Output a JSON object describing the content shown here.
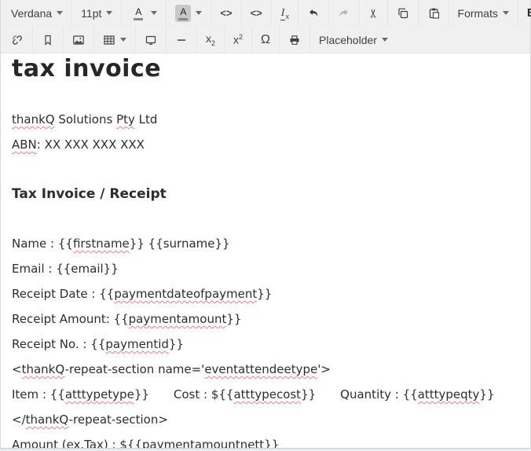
{
  "colors": {
    "toolbar_bg": "#f0f0f1",
    "icon": "#404040",
    "text": "#2d2d2d",
    "spellcheck_underline": "#f28080",
    "color_swatch": "#8a8a8a",
    "active_button_bg": "#c8c8c9"
  },
  "toolbar": {
    "row1": {
      "font_family": {
        "label": "Verdana",
        "type": "dropdown"
      },
      "font_size": {
        "label": "11pt",
        "type": "dropdown"
      },
      "text_color": {
        "glyph": "A",
        "icon": "text-color-icon",
        "swatch": "#8a8a8a"
      },
      "bg_color": {
        "glyph": "A",
        "icon": "background-color-icon",
        "swatch": "#8a8a8a",
        "active": true
      },
      "source_code": {
        "glyph": "<>",
        "icon": "source-code-icon"
      },
      "code_sample": {
        "glyph": "<>",
        "icon": "code-sample-icon"
      },
      "clear_formatting": {
        "glyph_base": "I",
        "glyph_sub": "x",
        "icon": "clear-formatting-icon"
      },
      "undo": {
        "icon": "undo-icon"
      },
      "redo": {
        "icon": "redo-icon",
        "disabled": true
      },
      "cut": {
        "glyph": "✂",
        "icon": "cut-icon"
      },
      "copy": {
        "icon": "copy-icon"
      },
      "paste": {
        "icon": "paste-icon"
      },
      "formats": {
        "label": "Formats",
        "type": "dropdown"
      },
      "bold": {
        "label": "B"
      }
    },
    "row2": {
      "unlink": {
        "icon": "unlink-icon"
      },
      "anchor": {
        "icon": "anchor-bookmark-icon"
      },
      "image": {
        "icon": "image-icon"
      },
      "table": {
        "icon": "table-icon",
        "type": "dropdown"
      },
      "preview": {
        "icon": "preview-monitor-icon"
      },
      "horizontal_rule": {
        "icon": "horizontal-rule-icon"
      },
      "subscript": {
        "glyph_base": "x",
        "glyph_sub": "2",
        "icon": "subscript-icon"
      },
      "superscript": {
        "glyph_base": "x",
        "glyph_sup": "2",
        "icon": "superscript-icon"
      },
      "special_char": {
        "glyph": "Ω",
        "icon": "special-character-icon"
      },
      "print": {
        "icon": "print-icon"
      },
      "placeholder": {
        "label": "Placeholder",
        "type": "dropdown"
      }
    }
  },
  "document": {
    "title": "tax invoice",
    "company_line": {
      "segments": [
        {
          "text": "thankQ",
          "misspelled": true
        },
        {
          "text": " Solutions ",
          "misspelled": false
        },
        {
          "text": "Pty",
          "misspelled": true
        },
        {
          "text": " Ltd",
          "misspelled": false
        }
      ]
    },
    "abn_line": {
      "segments": [
        {
          "text": "ABN",
          "misspelled": true
        },
        {
          "text": ": XX XXX XXX XXX",
          "misspelled": false
        }
      ]
    },
    "subheading": "Tax Invoice / Receipt",
    "name_line": {
      "segments": [
        {
          "text": "Name : {{",
          "misspelled": false
        },
        {
          "text": "firstname",
          "misspelled": true
        },
        {
          "text": "}} {{surname}}",
          "misspelled": false
        }
      ]
    },
    "email_line": {
      "segments": [
        {
          "text": "Email : {{email}}",
          "misspelled": false
        }
      ]
    },
    "receipt_date_line": {
      "segments": [
        {
          "text": "Receipt Date : {{",
          "misspelled": false
        },
        {
          "text": "paymentdateofpayment",
          "misspelled": true
        },
        {
          "text": "}}",
          "misspelled": false
        }
      ]
    },
    "receipt_amount_line": {
      "segments": [
        {
          "text": "Receipt Amount: {{",
          "misspelled": false
        },
        {
          "text": "paymentamount",
          "misspelled": true
        },
        {
          "text": "}}",
          "misspelled": false
        }
      ]
    },
    "receipt_no_line": {
      "segments": [
        {
          "text": "Receipt No. : {{",
          "misspelled": false
        },
        {
          "text": "paymentid",
          "misspelled": true
        },
        {
          "text": "}}",
          "misspelled": false
        }
      ]
    },
    "repeat_open_line": {
      "segments": [
        {
          "text": "<",
          "misspelled": false
        },
        {
          "text": "thankQ",
          "misspelled": true
        },
        {
          "text": "-repeat-section name='",
          "misspelled": false
        },
        {
          "text": "eventattendeetype",
          "misspelled": true
        },
        {
          "text": "'>",
          "misspelled": false
        }
      ]
    },
    "item_line": {
      "segments": [
        {
          "text": "Item : {{",
          "misspelled": false
        },
        {
          "text": "atttypetype",
          "misspelled": true
        },
        {
          "text": "}}",
          "misspelled": false
        },
        {
          "text": "Cost : ${{",
          "misspelled": false
        },
        {
          "text": "atttypecost",
          "misspelled": true
        },
        {
          "text": "}}",
          "misspelled": false
        },
        {
          "text": "Quantity : {{",
          "misspelled": false
        },
        {
          "text": "atttypeqty",
          "misspelled": true
        },
        {
          "text": "}}",
          "misspelled": false
        }
      ]
    },
    "repeat_close_line": {
      "segments": [
        {
          "text": "</",
          "misspelled": false
        },
        {
          "text": "thankQ",
          "misspelled": true
        },
        {
          "text": "-repeat-section>",
          "misspelled": false
        }
      ]
    },
    "amount_line": {
      "segments": [
        {
          "text": "Amount (ex.Tax) : ${{",
          "misspelled": false
        },
        {
          "text": "paymentamountnett",
          "misspelled": true
        },
        {
          "text": "}}",
          "misspelled": false
        }
      ]
    }
  }
}
